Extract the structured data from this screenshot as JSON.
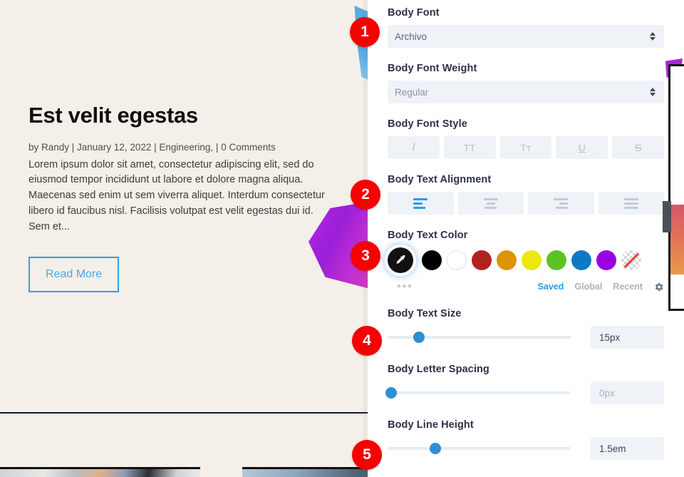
{
  "preview": {
    "post_title": "Est velit egestas",
    "post_meta": "by Randy | January 12, 2022 | Engineering, | 0 Comments",
    "post_excerpt": "Lorem ipsum dolor sit amet, consectetur adipiscing elit, sed do eiusmod tempor incididunt ut labore et dolore magna aliqua. Maecenas sed enim ut sem viverra aliquet. Interdum consectetur libero id faucibus nisl. Facilisis volutpat est velit egestas dui id. Sem et...",
    "read_more_label": "Read More"
  },
  "panel": {
    "body_font": {
      "label": "Body Font",
      "value": "Archivo"
    },
    "body_font_weight": {
      "label": "Body Font Weight",
      "value": "Regular"
    },
    "body_font_style": {
      "label": "Body Font Style",
      "options": [
        {
          "name": "italic",
          "glyph": "I"
        },
        {
          "name": "uppercase",
          "glyph": "TT"
        },
        {
          "name": "small-caps",
          "glyph": "Tᴛ"
        },
        {
          "name": "underline",
          "glyph": "U"
        },
        {
          "name": "strikethrough",
          "glyph": "S"
        }
      ]
    },
    "body_text_alignment": {
      "label": "Body Text Alignment",
      "options": [
        "left",
        "center",
        "right",
        "justify"
      ],
      "selected": "left"
    },
    "body_text_color": {
      "label": "Body Text Color",
      "eyedropper_icon": "eyedropper-icon",
      "more_icon": "more-dots-icon",
      "swatches": [
        {
          "name": "black",
          "hex": "#000000"
        },
        {
          "name": "white",
          "hex": "#ffffff"
        },
        {
          "name": "dark-red",
          "hex": "#b32020"
        },
        {
          "name": "orange",
          "hex": "#dd9400"
        },
        {
          "name": "yellow",
          "hex": "#ece80e"
        },
        {
          "name": "green",
          "hex": "#5dc228"
        },
        {
          "name": "blue",
          "hex": "#0c79c6"
        },
        {
          "name": "purple",
          "hex": "#9a00e2"
        },
        {
          "name": "transparent",
          "hex": "transparent"
        }
      ],
      "tabs": [
        {
          "label": "Saved",
          "active": true
        },
        {
          "label": "Global",
          "active": false
        },
        {
          "label": "Recent",
          "active": false
        }
      ],
      "settings_icon": "gear-icon"
    },
    "body_text_size": {
      "label": "Body Text Size",
      "value": "15px",
      "is_placeholder": false,
      "slider_percent": 17
    },
    "body_letter_spacing": {
      "label": "Body Letter Spacing",
      "value": "0px",
      "is_placeholder": true,
      "slider_percent": 2
    },
    "body_line_height": {
      "label": "Body Line Height",
      "value": "1.5em",
      "is_placeholder": false,
      "slider_percent": 26
    }
  },
  "callouts": [
    {
      "number": "1",
      "target": "body-font-select"
    },
    {
      "number": "2",
      "target": "body-text-alignment"
    },
    {
      "number": "3",
      "target": "body-text-color"
    },
    {
      "number": "4",
      "target": "body-text-size"
    },
    {
      "number": "5",
      "target": "body-line-height"
    }
  ],
  "colors": {
    "accent_blue": "#2d9ce8",
    "badge_red": "#f60000",
    "panel_bg": "#ffffff",
    "preview_bg": "#f4efe8",
    "field_bg": "#eff2f6"
  }
}
